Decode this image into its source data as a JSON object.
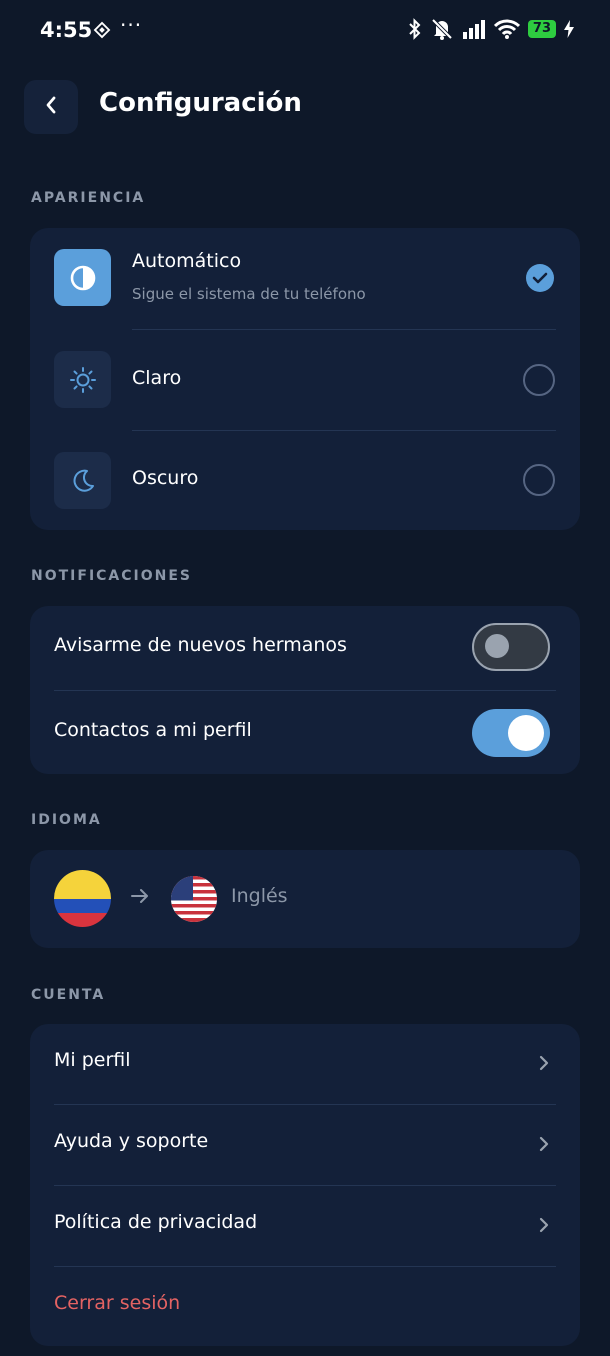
{
  "status_bar": {
    "time": "4:55",
    "extra_icon": "diamond-icon",
    "more": "···",
    "battery": "73"
  },
  "header": {
    "title": "Configuración",
    "back_icon": "chevron-left-icon"
  },
  "appearance": {
    "label": "APARIENCIA",
    "options": [
      {
        "title": "Automático",
        "subtitle": "Sigue el sistema de tu teléfono",
        "icon": "contrast-icon",
        "selected": true
      },
      {
        "title": "Claro",
        "icon": "sun-icon",
        "selected": false
      },
      {
        "title": "Oscuro",
        "icon": "moon-icon",
        "selected": false
      }
    ]
  },
  "notifications": {
    "label": "NOTIFICACIONES",
    "items": [
      {
        "title": "Avisarme de nuevos hermanos",
        "enabled": false
      },
      {
        "title": "Contactos a mi perfil",
        "enabled": true
      }
    ]
  },
  "language": {
    "label": "IDIOMA",
    "from_flag": "colombia-flag-icon",
    "arrow": "→",
    "to_flag": "usa-flag-icon",
    "target": "Inglés"
  },
  "account": {
    "label": "CUENTA",
    "items": [
      {
        "title": "Mi perfil"
      },
      {
        "title": "Ayuda y soporte"
      },
      {
        "title": "Política de privacidad"
      }
    ],
    "logout": "Cerrar sesión"
  },
  "colors": {
    "background": "#0e1829",
    "card": "#132039",
    "accent": "#5b9fdb",
    "danger": "#e46363",
    "muted": "#8c97a8"
  }
}
